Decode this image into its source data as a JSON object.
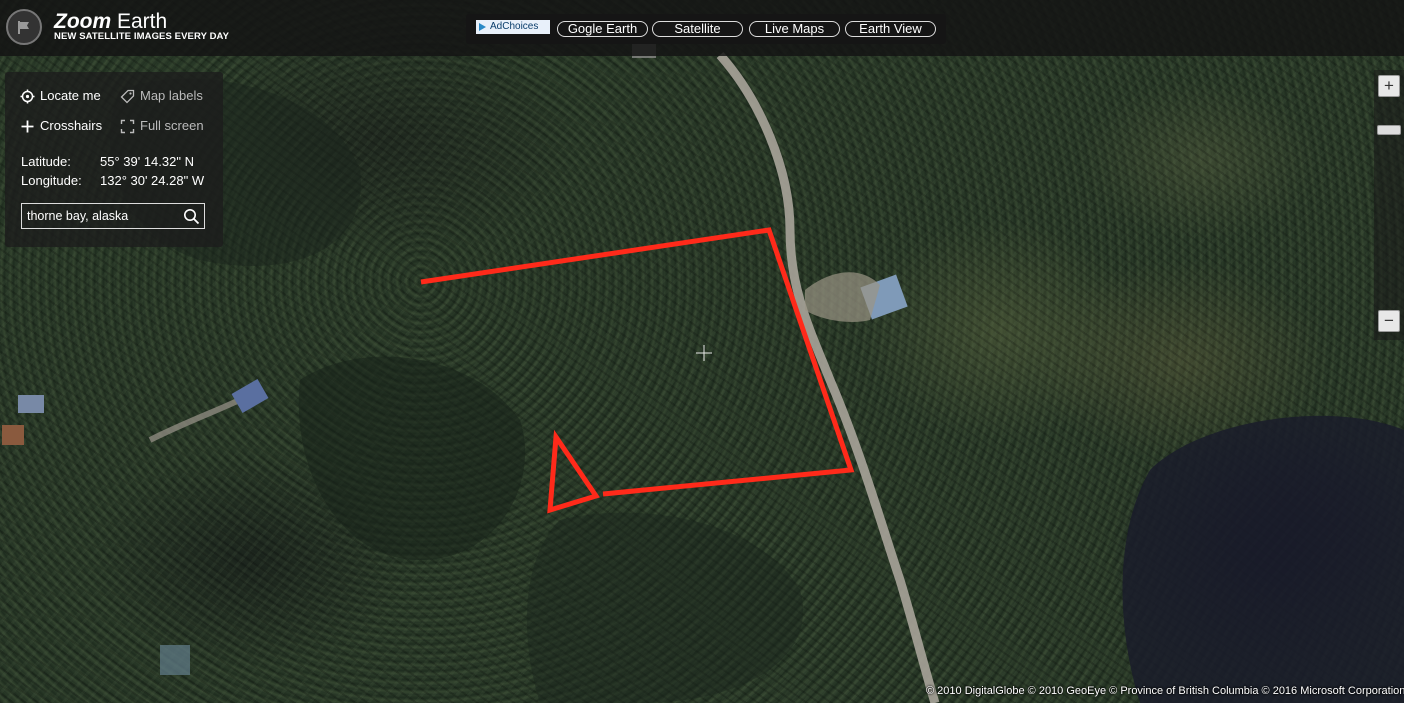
{
  "brand": {
    "name_bold": "Zoom",
    "name_rest": " Earth",
    "tagline": "NEW SATELLITE IMAGES EVERY DAY"
  },
  "topnav": {
    "adchoices": "AdChoices",
    "links": [
      "Gogle Earth",
      "Satellite",
      "Live Maps",
      "Earth View"
    ]
  },
  "controls": {
    "locate_me": "Locate me",
    "map_labels": "Map labels",
    "crosshairs": "Crosshairs",
    "full_screen": "Full screen"
  },
  "coordinates": {
    "latitude_label": "Latitude:",
    "latitude_value": "55° 39' 14.32\" N",
    "longitude_label": "Longitude:",
    "longitude_value": "132° 30' 24.28\" W"
  },
  "search": {
    "value": "thorne bay, alaska"
  },
  "zoom": {
    "in_label": "+",
    "out_label": "−"
  },
  "attribution": "© 2010 DigitalGlobe © 2010 GeoEye © Province of British Columbia © 2016 Microsoft Corporation",
  "colors": {
    "boundary": "#ff2a1a",
    "road": "#a8a49a",
    "panel": "#1c1c1c"
  },
  "icons": [
    "logo-flag-icon",
    "locate-icon",
    "tag-icon",
    "crosshairs-plus-icon",
    "fullscreen-icon",
    "search-icon",
    "map-crosshair-icon"
  ]
}
